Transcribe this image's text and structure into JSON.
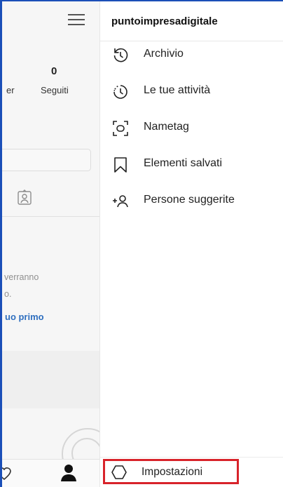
{
  "profile_bg": {
    "following_count": "0",
    "following_label": "Seguiti",
    "followers_label_cut": "er",
    "empty_text_line1": "verranno",
    "empty_text_line2": "o.",
    "link_cut": "uo primo"
  },
  "drawer": {
    "username": "puntoimpresadigitale",
    "items": [
      {
        "icon": "archive-icon",
        "label": "Archivio"
      },
      {
        "icon": "activity-clock-icon",
        "label": "Le tue attività"
      },
      {
        "icon": "nametag-icon",
        "label": "Nametag"
      },
      {
        "icon": "bookmark-icon",
        "label": "Elementi salvati"
      },
      {
        "icon": "add-person-icon",
        "label": "Persone suggerite"
      }
    ],
    "settings": {
      "icon": "settings-icon",
      "label": "Impostazioni"
    }
  },
  "colors": {
    "highlight_border": "#d8232a",
    "link": "#2f6fbf",
    "frame_line": "#1b4fb8"
  }
}
